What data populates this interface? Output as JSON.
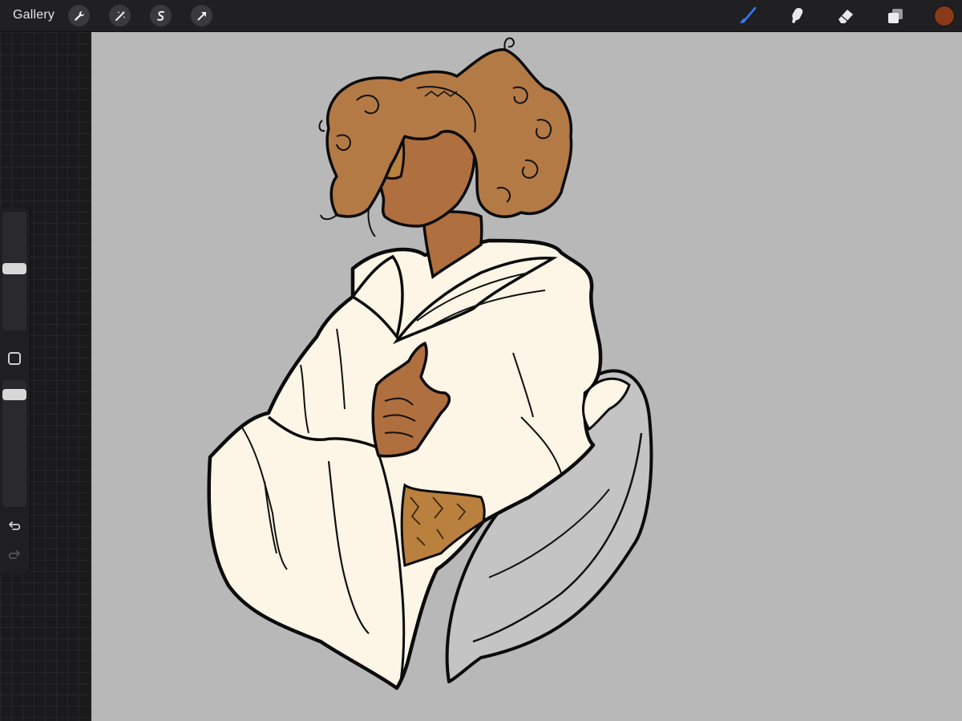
{
  "topbar": {
    "gallery_label": "Gallery",
    "left_tools": [
      "wrench-icon",
      "magic-wand-icon",
      "selection-icon",
      "transform-arrow-icon"
    ],
    "right_tools": [
      "brush-icon",
      "smudge-icon",
      "eraser-icon",
      "layers-icon"
    ],
    "active_tool": "brush-icon",
    "active_tool_color": "#2f7df6",
    "current_color": "#8a3a1a"
  },
  "sidebar": {
    "brush_size_level": 0.48,
    "opacity_level": 0.9,
    "icons": [
      "modify-square-icon",
      "undo-icon",
      "redo-icon"
    ]
  },
  "canvas": {
    "background_color": "#b8b8b8",
    "artwork": "figure-drawing"
  }
}
